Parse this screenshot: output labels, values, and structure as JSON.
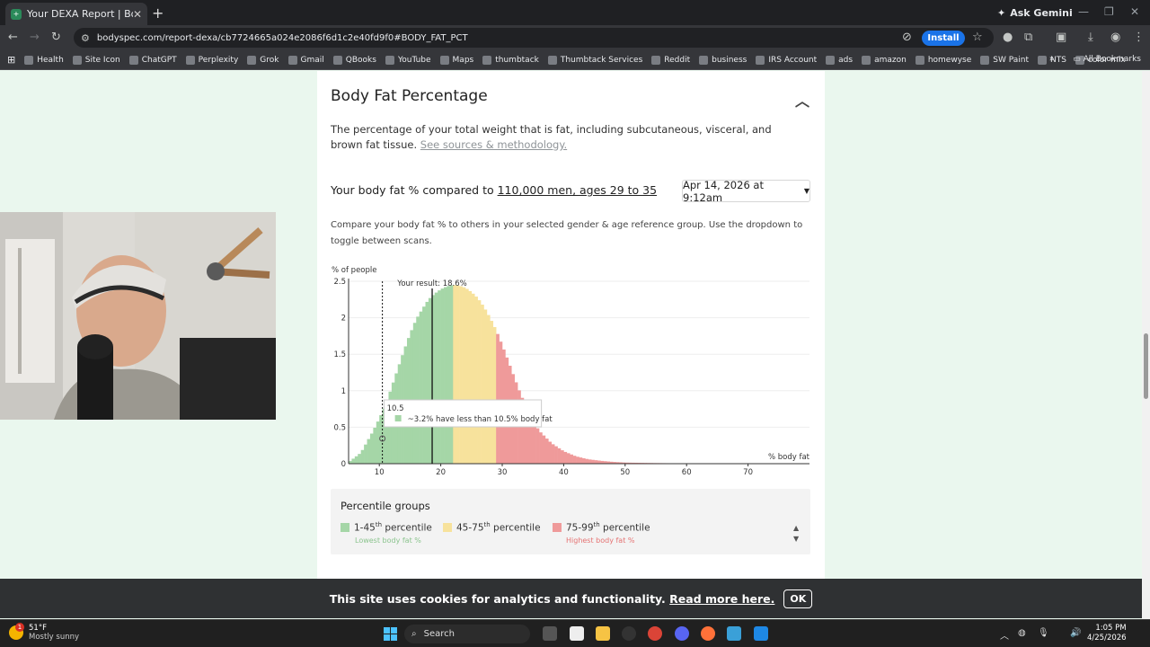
{
  "browser": {
    "tab_title": "Your DEXA Report | BodySpec",
    "ask_gemini": "Ask Gemini",
    "url": "bodyspec.com/report-dexa/cb7724665a024e2086f6d1c2e40fd9f0#BODY_FAT_PCT",
    "install_label": "Install",
    "bookmarks": [
      "Health",
      "Site Icon",
      "ChatGPT",
      "Perplexity",
      "Grok",
      "Gmail",
      "QBooks",
      "YouTube",
      "Maps",
      "thumbtack",
      "Thumbtack Services",
      "Reddit",
      "business",
      "IRS Account",
      "ads",
      "amazon",
      "homewyse",
      "SW Paint",
      "NTS",
      "color mix"
    ],
    "all_bookmarks": "All Bookmarks"
  },
  "section": {
    "title": "Body Fat Percentage",
    "description": "The percentage of your total weight that is fat, including subcutaneous, visceral, and brown fat tissue.",
    "sources_link": "See sources & methodology.",
    "compare_prefix": "Your body fat % compared to ",
    "compare_link": "110,000 men, ages 29 to 35",
    "scan_date": "Apr 14, 2026 at 9:12am",
    "help_text": "Compare your body fat % to others in your selected gender & age reference group. Use the dropdown to toggle between scans."
  },
  "chart_data": {
    "type": "area",
    "ylabel": "% of people",
    "xlabel": "% body fat",
    "ylim": [
      0,
      2.5
    ],
    "yticks": [
      "0",
      "0.5",
      "1",
      "1.5",
      "2",
      "2.5"
    ],
    "xticks": [
      "10",
      "20",
      "30",
      "40",
      "50",
      "60",
      "70"
    ],
    "grid": true,
    "result_label": "Your result: 18.6%",
    "result_value": 18.6,
    "hover_value_label": "10.5",
    "hover_value": 10.5,
    "tooltip_text": "~3.2% have less than 10.5% body fat",
    "segment_breaks": [
      21.9,
      28.9
    ],
    "colors": {
      "low": "#a5d6a7",
      "mid": "#f7e29c",
      "high": "#ef9a9a"
    },
    "x": [
      5,
      7,
      8,
      9,
      10,
      11,
      12,
      13,
      14,
      15,
      16,
      17,
      18,
      19,
      20,
      21,
      22,
      23,
      24,
      25,
      26,
      27,
      28,
      29,
      30,
      31,
      32,
      33,
      34,
      35,
      36,
      38,
      40,
      42,
      44,
      46,
      48,
      50,
      55,
      60,
      70
    ],
    "y": [
      0.02,
      0.15,
      0.3,
      0.45,
      0.62,
      0.8,
      1.05,
      1.3,
      1.55,
      1.78,
      1.98,
      2.12,
      2.25,
      2.33,
      2.39,
      2.43,
      2.45,
      2.44,
      2.41,
      2.35,
      2.27,
      2.15,
      2.0,
      1.83,
      1.62,
      1.4,
      1.17,
      0.95,
      0.76,
      0.59,
      0.45,
      0.28,
      0.17,
      0.1,
      0.06,
      0.04,
      0.025,
      0.015,
      0.008,
      0.004,
      0.001
    ]
  },
  "percentile_groups": {
    "title": "Percentile groups",
    "groups": [
      {
        "label": "1-45",
        "suffix": "th",
        "word": " percentile",
        "sub": "Lowest body fat %"
      },
      {
        "label": "45-75",
        "suffix": "th",
        "word": " percentile",
        "sub": ""
      },
      {
        "label": "75-99",
        "suffix": "th",
        "word": " percentile",
        "sub": "Highest body fat %"
      }
    ]
  },
  "cookie": {
    "message": "This site uses cookies for analytics and functionality.",
    "link": "Read more here.",
    "ok": "OK"
  },
  "taskbar": {
    "temp": "51°F",
    "weather": "Mostly sunny",
    "weather_badge": "1",
    "search": "Search",
    "time": "1:05 PM",
    "date": "4/25/2026"
  }
}
